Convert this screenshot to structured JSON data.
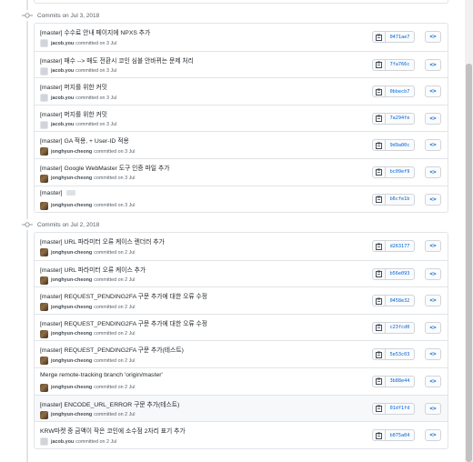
{
  "groups": [
    {
      "header": "Commits on Jul 3, 2018",
      "commits": [
        {
          "message": "[master] 수수료 안내 페이지에 NPXS 추가",
          "author": "jacob.you",
          "date": "committed on 3 Jul",
          "sha": "0471ae7",
          "avatar": "gray",
          "highlight": false,
          "ellipsis": false
        },
        {
          "message": "[master] 매수 --> 매도 전환시 코인 심볼 안바뀌는 문제 처리",
          "author": "jacob.you",
          "date": "committed on 3 Jul",
          "sha": "7fa766c",
          "avatar": "gray",
          "highlight": false,
          "ellipsis": false
        },
        {
          "message": "[master] 머지를 위한 커밋",
          "author": "jacob.you",
          "date": "committed on 3 Jul",
          "sha": "0bbecb7",
          "avatar": "gray",
          "highlight": false,
          "ellipsis": false
        },
        {
          "message": "[master] 머지를 위한 커밋",
          "author": "jacob.you",
          "date": "committed on 3 Jul",
          "sha": "7a294fe",
          "avatar": "gray",
          "highlight": false,
          "ellipsis": false
        },
        {
          "message": "[master] GA 적용, + User-ID 적용",
          "author": "jonghyun-cheong",
          "date": "committed on 3 Jul",
          "sha": "9d9a00c",
          "avatar": "brown",
          "highlight": false,
          "ellipsis": false
        },
        {
          "message": "[master] Google WebMaster 도구 인증 파일 추가",
          "author": "jonghyun-cheong",
          "date": "committed on 3 Jul",
          "sha": "bc09ef9",
          "avatar": "brown",
          "highlight": false,
          "ellipsis": false
        },
        {
          "message": "[master]",
          "author": "jonghyun-cheong",
          "date": "committed on 3 Jul",
          "sha": "b6cfe1b",
          "avatar": "brown",
          "highlight": false,
          "ellipsis": true
        }
      ]
    },
    {
      "header": "Commits on Jul 2, 2018",
      "commits": [
        {
          "message": "[master] URL 파라미터 오류 케이스 렌더러 추가",
          "author": "jonghyun-cheong",
          "date": "committed on 2 Jul",
          "sha": "d263177",
          "avatar": "brown",
          "highlight": false,
          "ellipsis": false
        },
        {
          "message": "[master] URL 파라미터 오류 케이스 추가",
          "author": "jonghyun-cheong",
          "date": "committed on 2 Jul",
          "sha": "b56e093",
          "avatar": "brown",
          "highlight": false,
          "ellipsis": false
        },
        {
          "message": "[master] REQUEST_PENDING2FA 구문 추가에 대한 오류 수정",
          "author": "jonghyun-cheong",
          "date": "committed on 2 Jul",
          "sha": "0458e32",
          "avatar": "brown",
          "highlight": false,
          "ellipsis": false
        },
        {
          "message": "[master] REQUEST_PENDING2FA 구문 추가에 대한 오류 수정",
          "author": "jonghyun-cheong",
          "date": "committed on 2 Jul",
          "sha": "c23fcd0",
          "avatar": "brown",
          "highlight": false,
          "ellipsis": false
        },
        {
          "message": "[master] REQUEST_PENDING2FA 구문 추가(테스트)",
          "author": "jonghyun-cheong",
          "date": "committed on 2 Jul",
          "sha": "5e53c03",
          "avatar": "brown",
          "highlight": false,
          "ellipsis": false
        },
        {
          "message": "Merge remote-tracking branch 'origin/master'",
          "author": "jonghyun-cheong",
          "date": "committed on 2 Jul",
          "sha": "3b88e44",
          "avatar": "brown",
          "highlight": false,
          "ellipsis": false
        },
        {
          "message": "[master] ENCODE_URL_ERROR 구문 추가(테스트)",
          "author": "jonghyun-cheong",
          "date": "committed on 2 Jul",
          "sha": "01df1fd",
          "avatar": "brown",
          "highlight": true,
          "ellipsis": false
        },
        {
          "message": "KRW마켓 중 금액이 작은 코인에 소수점 2자리 표기 추가",
          "author": "jacob.you",
          "date": "committed on 2 Jul",
          "sha": "b075a04",
          "avatar": "gray",
          "highlight": false,
          "ellipsis": false
        }
      ]
    }
  ],
  "icons": {
    "commit": "commit-icon",
    "copy": "clipboard-icon",
    "browse": "code-icon"
  },
  "browse_label": "<>",
  "colors": {
    "link": "#0366d6",
    "border": "#e1e4e8",
    "text": "#24292e",
    "muted": "#586069",
    "highlight_row": "#f6f8fa"
  }
}
